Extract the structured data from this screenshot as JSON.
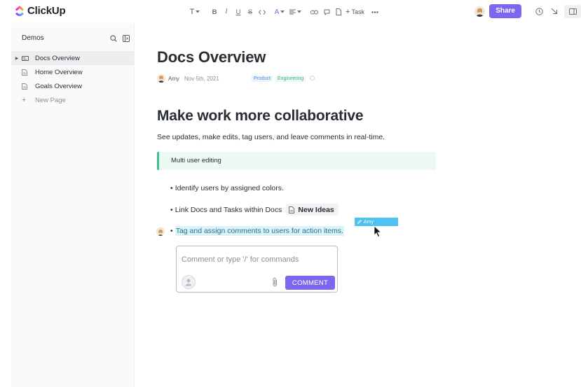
{
  "app": {
    "name": "ClickUp",
    "brand_color": "#7b68ee"
  },
  "toolbar": {
    "task_label": "Task",
    "share_label": "Share"
  },
  "sidebar": {
    "title": "Demos",
    "items": [
      {
        "label": "Docs Overview",
        "active": true
      },
      {
        "label": "Home Overview",
        "active": false
      },
      {
        "label": "Goals Overview",
        "active": false
      }
    ],
    "new_page_label": "New Page"
  },
  "doc": {
    "title": "Docs Overview",
    "author": "Amy",
    "date": "Nov 5th, 2021",
    "tags": [
      "Product",
      "Engineering"
    ],
    "heading": "Make work more collaborative",
    "subtitle": "See updates, make edits, tag users, and leave comments in real-time.",
    "callout": "Multi user editing",
    "bullets": [
      "Identify users by assigned colors.",
      "Link Docs and Tasks within Docs",
      "Tag and assign comments to users for action items."
    ],
    "linked_doc": "New Ideas",
    "cursor_user": "Amy"
  },
  "comment": {
    "placeholder": "Comment or type '/' for commands",
    "button_label": "COMMENT"
  }
}
